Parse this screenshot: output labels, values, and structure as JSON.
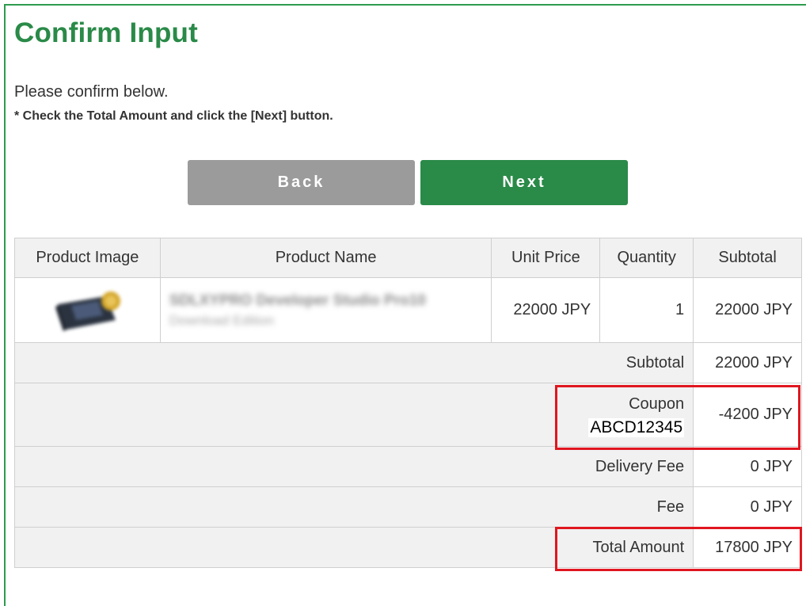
{
  "page": {
    "title": "Confirm Input",
    "intro": "Please confirm below.",
    "note": "* Check the Total Amount and click the [Next] button."
  },
  "buttons": {
    "back_label": "Back",
    "next_label": "Next"
  },
  "table": {
    "headers": {
      "image": "Product Image",
      "name": "Product Name",
      "unit_price": "Unit Price",
      "quantity": "Quantity",
      "subtotal": "Subtotal"
    },
    "item": {
      "name": "SDLXYPRO Developer Studio Pro10",
      "edition": "Download Edition",
      "unit_price": "22000 JPY",
      "quantity": "1",
      "subtotal": "22000 JPY"
    },
    "summary": {
      "subtotal_label": "Subtotal",
      "subtotal_value": "22000 JPY",
      "coupon_label": "Coupon",
      "coupon_code": "ABCD12345",
      "coupon_value": "-4200 JPY",
      "delivery_label": "Delivery Fee",
      "delivery_value": "0 JPY",
      "fee_label": "Fee",
      "fee_value": "0 JPY",
      "total_label": "Total Amount",
      "total_value": "17800 JPY"
    }
  },
  "colors": {
    "brand_green": "#2a8a48",
    "back_gray": "#9b9b9b",
    "highlight_red": "#e0161f"
  }
}
